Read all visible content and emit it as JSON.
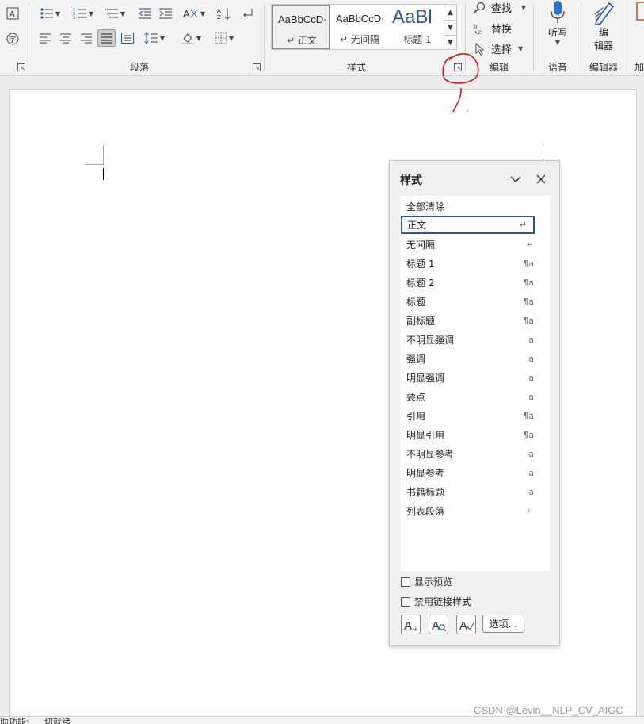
{
  "ribbon": {
    "groups": {
      "paragraph": "段落",
      "styles": "样式",
      "editing": "编辑",
      "voice": "语音",
      "editor": "编辑器",
      "addins_partial": "加"
    },
    "gallery": [
      {
        "sample": "AaBbCcD·",
        "name": "↵ 正文"
      },
      {
        "sample": "AaBbCcD·",
        "name": "↵ 无间隔"
      },
      {
        "sample": "AaBl",
        "name": "标题 1"
      }
    ],
    "editing": {
      "find": "查找",
      "replace": "替换",
      "select": "选择"
    },
    "dictate": "听写",
    "editor_btn_line1": "编",
    "editor_btn_line2": "辑器"
  },
  "styles_pane": {
    "title": "样式",
    "items": [
      {
        "name": "全部清除",
        "mark": ""
      },
      {
        "name": "正文",
        "mark": "↵"
      },
      {
        "name": "无间隔",
        "mark": "↵"
      },
      {
        "name": "标题 1",
        "mark": "¶a"
      },
      {
        "name": "标题 2",
        "mark": "¶a"
      },
      {
        "name": "标题",
        "mark": "¶a"
      },
      {
        "name": "副标题",
        "mark": "¶a"
      },
      {
        "name": "不明显强调",
        "mark": "a"
      },
      {
        "name": "强调",
        "mark": "a"
      },
      {
        "name": "明显强调",
        "mark": "a"
      },
      {
        "name": "要点",
        "mark": "a"
      },
      {
        "name": "引用",
        "mark": "¶a"
      },
      {
        "name": "明显引用",
        "mark": "¶a"
      },
      {
        "name": "不明显参考",
        "mark": "a"
      },
      {
        "name": "明显参考",
        "mark": "a"
      },
      {
        "name": "书籍标题",
        "mark": "a"
      },
      {
        "name": "列表段落",
        "mark": "↵"
      }
    ],
    "show_preview": "显示预览",
    "disable_linked": "禁用链接样式",
    "options_button": "选项..."
  },
  "status": {
    "accessibility_partial": "助功能:",
    "ready_partial": "切就绪"
  },
  "watermark": "CSDN @Levin__NLP_CV_AIGC",
  "colors": {
    "annotation": "#e0141e",
    "selected_border": "#2b579a"
  }
}
